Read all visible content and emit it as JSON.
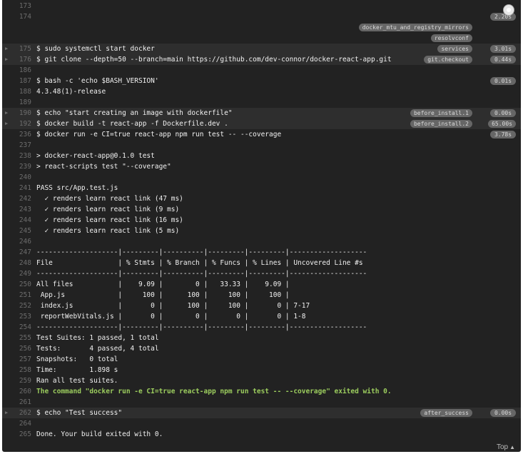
{
  "log": {
    "lines": [
      {
        "num": "173",
        "text": "",
        "fold": false
      },
      {
        "num": "174",
        "text": "",
        "fold": false,
        "time": "2.20s"
      },
      {
        "num": "",
        "text": "",
        "fold": false,
        "folds": [
          "docker_mtu_and_registry_mirrors"
        ]
      },
      {
        "num": "",
        "text": "",
        "fold": false,
        "folds": [
          "resolvconf"
        ]
      },
      {
        "num": "175",
        "text": "$ sudo systemctl start docker",
        "fold": true,
        "folds": [
          "services"
        ],
        "time": "3.01s"
      },
      {
        "num": "176",
        "text": "$ git clone --depth=50 --branch=main https://github.com/dev-connor/docker-react-app.git",
        "fold": true,
        "folds": [
          "git.checkout"
        ],
        "time": "0.44s"
      },
      {
        "num": "186",
        "text": "",
        "fold": false
      },
      {
        "num": "187",
        "text": "$ bash -c 'echo $BASH_VERSION'",
        "fold": false,
        "time": "0.01s"
      },
      {
        "num": "188",
        "text": "4.3.48(1)-release",
        "fold": false
      },
      {
        "num": "189",
        "text": "",
        "fold": false
      },
      {
        "num": "190",
        "text": "$ echo \"start creating an image with dockerfile\"",
        "fold": true,
        "folds": [
          "before_install.1"
        ],
        "time": "0.00s"
      },
      {
        "num": "192",
        "text": "$ docker build -t react-app -f Dockerfile.dev .",
        "fold": true,
        "folds": [
          "before_install.2"
        ],
        "time": "65.00s"
      },
      {
        "num": "236",
        "text": "$ docker run -e CI=true react-app npm run test -- --coverage",
        "fold": false,
        "time": "3.78s"
      },
      {
        "num": "237",
        "text": "",
        "fold": false
      },
      {
        "num": "238",
        "text": "> docker-react-app@0.1.0 test",
        "fold": false
      },
      {
        "num": "239",
        "text": "> react-scripts test \"--coverage\"",
        "fold": false
      },
      {
        "num": "240",
        "text": "",
        "fold": false
      },
      {
        "num": "241",
        "text": "PASS src/App.test.js",
        "fold": false
      },
      {
        "num": "242",
        "text": "  ✓ renders learn react link (47 ms)",
        "fold": false
      },
      {
        "num": "243",
        "text": "  ✓ renders learn react link (9 ms)",
        "fold": false
      },
      {
        "num": "244",
        "text": "  ✓ renders learn react link (16 ms)",
        "fold": false
      },
      {
        "num": "245",
        "text": "  ✓ renders learn react link (5 ms)",
        "fold": false
      },
      {
        "num": "246",
        "text": "",
        "fold": false
      },
      {
        "num": "247",
        "text": "--------------------|---------|----------|---------|---------|-------------------",
        "fold": false
      },
      {
        "num": "248",
        "text": "File                | % Stmts | % Branch | % Funcs | % Lines | Uncovered Line #s",
        "fold": false
      },
      {
        "num": "249",
        "text": "--------------------|---------|----------|---------|---------|-------------------",
        "fold": false
      },
      {
        "num": "250",
        "text": "All files           |    9.09 |        0 |   33.33 |    9.09 |",
        "fold": false
      },
      {
        "num": "251",
        "text": " App.js             |     100 |      100 |     100 |     100 |",
        "fold": false
      },
      {
        "num": "252",
        "text": " index.js           |       0 |      100 |     100 |       0 | 7-17",
        "fold": false
      },
      {
        "num": "253",
        "text": " reportWebVitals.js |       0 |        0 |       0 |       0 | 1-8",
        "fold": false
      },
      {
        "num": "254",
        "text": "--------------------|---------|----------|---------|---------|-------------------",
        "fold": false
      },
      {
        "num": "255",
        "text": "Test Suites: 1 passed, 1 total",
        "fold": false
      },
      {
        "num": "256",
        "text": "Tests:       4 passed, 4 total",
        "fold": false
      },
      {
        "num": "257",
        "text": "Snapshots:   0 total",
        "fold": false
      },
      {
        "num": "258",
        "text": "Time:        1.898 s",
        "fold": false
      },
      {
        "num": "259",
        "text": "Ran all test suites.",
        "fold": false
      },
      {
        "num": "260",
        "text": "The command \"docker run -e CI=true react-app npm run test -- --coverage\" exited with 0.",
        "fold": false,
        "green": true
      },
      {
        "num": "261",
        "text": "",
        "fold": false
      },
      {
        "num": "262",
        "text": "$ echo \"Test success\"",
        "fold": true,
        "folds": [
          "after_success"
        ],
        "time": "0.00s"
      },
      {
        "num": "264",
        "text": "",
        "fold": false
      },
      {
        "num": "265",
        "text": "Done. Your build exited with 0.",
        "fold": false
      }
    ],
    "top_link_label": "Top"
  },
  "icons": {
    "fold_arrow": "caret-right-icon",
    "scroll_top": "scroll-top-icon",
    "top_caret": "caret-up-icon"
  },
  "colors": {
    "background": "#222222",
    "fold_row": "#2e2e2e",
    "line_number": "#6c6c6c",
    "text": "#f1f1f1",
    "success_text": "#9ccd5e",
    "tag_background": "#666666"
  }
}
